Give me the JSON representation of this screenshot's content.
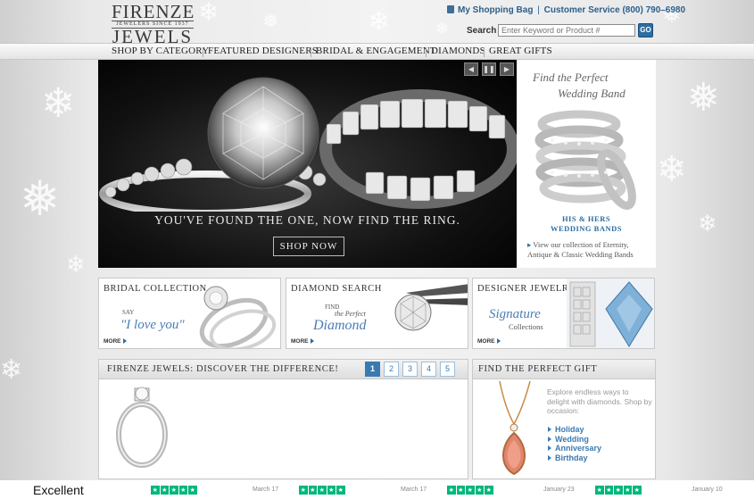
{
  "header": {
    "logo_line1": "FIRENZE",
    "logo_tagline": "JEWELERS SINCE 1937",
    "logo_line2": "JEWELS",
    "shopping_bag": "My Shopping Bag",
    "separator": "|",
    "customer_service": "Customer Service (800) 790–6980",
    "search_label": "Search",
    "search_placeholder": "Enter Keyword or Product #",
    "go_label": "GO"
  },
  "nav": {
    "items": [
      "SHOP BY CATEGORY",
      "FEATURED DESIGNERS",
      "BRIDAL & ENGAGEMENT",
      "DIAMONDS",
      "GREAT GIFTS"
    ]
  },
  "hero": {
    "caption": "YOU'VE FOUND THE ONE, NOW FIND THE RING.",
    "cta": "SHOP NOW",
    "controls": [
      "◀",
      "❚❚",
      "▶"
    ]
  },
  "promo": {
    "title_line1": "Find the Perfect",
    "title_line2": "Wedding Band",
    "heading_line1": "HIS & HERS",
    "heading_line2": "WEDDING BANDS",
    "desc_arrow": "▸",
    "desc": "View our collection of Eternity, Antique & Classic Wedding Bands"
  },
  "tiles": [
    {
      "title": "BRIDAL COLLECTION",
      "small": "SAY",
      "script": "\"I love you\"",
      "more": "MORE"
    },
    {
      "title": "DIAMOND SEARCH",
      "small": "FIND",
      "small2": "the Perfect",
      "script": "Diamond",
      "more": "MORE"
    },
    {
      "title": "DESIGNER JEWELRY",
      "script": "Signature",
      "small": "Collections",
      "more": "MORE"
    }
  ],
  "difference": {
    "title": "FIRENZE JEWELS: DISCOVER THE DIFFERENCE!",
    "pages": [
      "1",
      "2",
      "3",
      "4",
      "5"
    ],
    "active_page": "1"
  },
  "gift": {
    "title": "FIND THE PERFECT GIFT",
    "blurb": "Explore endless ways to delight with diamonds. Shop by occasion:",
    "occasions": [
      "Holiday",
      "Wedding",
      "Anniversary",
      "Birthday"
    ]
  },
  "reviews": {
    "rating_word": "Excellent",
    "star_glyph": "★",
    "dates": [
      "March 17",
      "March 17",
      "January 23",
      "January 10"
    ]
  },
  "colors": {
    "accent": "#2b5f8a",
    "link": "#3b7ab0",
    "trustpilot_green": "#00b67a"
  }
}
